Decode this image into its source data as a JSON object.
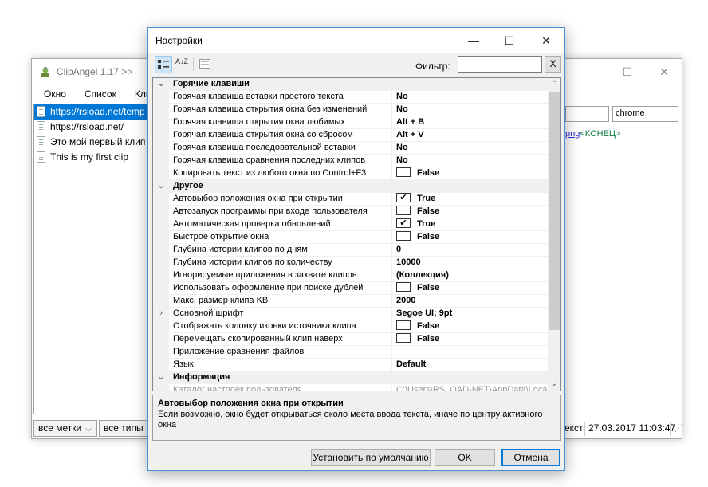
{
  "background_window": {
    "title": "ClipAngel 1.17 >>",
    "menu": [
      "Окно",
      "Список",
      "Кли"
    ],
    "clips": [
      {
        "text": "https://rsload.net/temp",
        "selected": true
      },
      {
        "text": "https://rsload.net/",
        "selected": false
      },
      {
        "text": "Это мой первый клип",
        "selected": false
      },
      {
        "text": "This is my first clip",
        "selected": false
      }
    ],
    "search_value": "",
    "app_filter_value": "chrome",
    "preview_link": "png",
    "preview_end": "<КОНЕЦ>",
    "marks_combo": "все метки",
    "types_combo": "все типы",
    "status_type": "екст",
    "status_date": "27.03.2017 11:03:47"
  },
  "dialog": {
    "title": "Настройки",
    "filter_label": "Фильтр:",
    "filter_value": "",
    "filter_clear": "X",
    "sort_az": "A↓Z",
    "rows": [
      {
        "kind": "cat",
        "expand": "⌄",
        "name": "Горячие клавиши"
      },
      {
        "kind": "prop",
        "name": "Горячая клавиша вставки простого текста",
        "value": "No"
      },
      {
        "kind": "prop",
        "name": "Горячая клавиша открытия окна без изменений",
        "value": "No"
      },
      {
        "kind": "prop",
        "name": "Горячая клавиша открытия окна любимых",
        "value": "Alt + B"
      },
      {
        "kind": "prop",
        "name": "Горячая клавиша открытия окна со сбросом",
        "value": "Alt + V"
      },
      {
        "kind": "prop",
        "name": "Горячая клавиша последовательной вставки",
        "value": "No"
      },
      {
        "kind": "prop",
        "name": "Горячая клавиша сравнения последних клипов",
        "value": "No"
      },
      {
        "kind": "bool",
        "name": "Копировать текст из любого окна по Control+F3",
        "value": "False",
        "checked": false
      },
      {
        "kind": "cat",
        "expand": "⌄",
        "name": "Другое"
      },
      {
        "kind": "bool",
        "name": "Автовыбор положения окна при открытии",
        "value": "True",
        "checked": true
      },
      {
        "kind": "bool",
        "name": "Автозапуск программы при входе пользователя",
        "value": "False",
        "checked": false
      },
      {
        "kind": "bool",
        "name": "Автоматическая проверка обновлений",
        "value": "True",
        "checked": true
      },
      {
        "kind": "bool",
        "name": "Быстрое открытие окна",
        "value": "False",
        "checked": false
      },
      {
        "kind": "prop",
        "name": "Глубина истории клипов по дням",
        "value": "0"
      },
      {
        "kind": "prop",
        "name": "Глубина истории клипов по количеству",
        "value": "10000"
      },
      {
        "kind": "prop",
        "name": "Игнорируемые приложения в захвате клипов",
        "value": "(Коллекция)"
      },
      {
        "kind": "bool",
        "name": "Использовать оформление при поиске дублей",
        "value": "False",
        "checked": false
      },
      {
        "kind": "prop",
        "name": "Макс. размер  клипа KB",
        "value": "2000"
      },
      {
        "kind": "prop",
        "expand": "›",
        "name": "Основной шрифт",
        "value": "Segoe UI; 9pt"
      },
      {
        "kind": "bool",
        "name": "Отображать колонку иконки источника клипа",
        "value": "False",
        "checked": false
      },
      {
        "kind": "bool",
        "name": "Перемещать скопированный клип наверх",
        "value": "False",
        "checked": false
      },
      {
        "kind": "prop",
        "name": "Приложение сравнения файлов",
        "value": ""
      },
      {
        "kind": "prop",
        "name": "Язык",
        "value": "Default"
      },
      {
        "kind": "cat",
        "expand": "⌄",
        "name": "Информация"
      },
      {
        "kind": "dim",
        "name": "Каталог настроек пользователя",
        "value": "C:\\Users\\RSLOAD-NET\\AppData\\Loca"
      }
    ],
    "help_title": "Автовыбор положения окна при открытии",
    "help_desc": "Если возможно, окно будет открываться около места ввода текста, иначе по центру активного окна",
    "buttons": {
      "reset": "Установить по умолчанию",
      "ok": "OK",
      "cancel": "Отмена"
    }
  }
}
